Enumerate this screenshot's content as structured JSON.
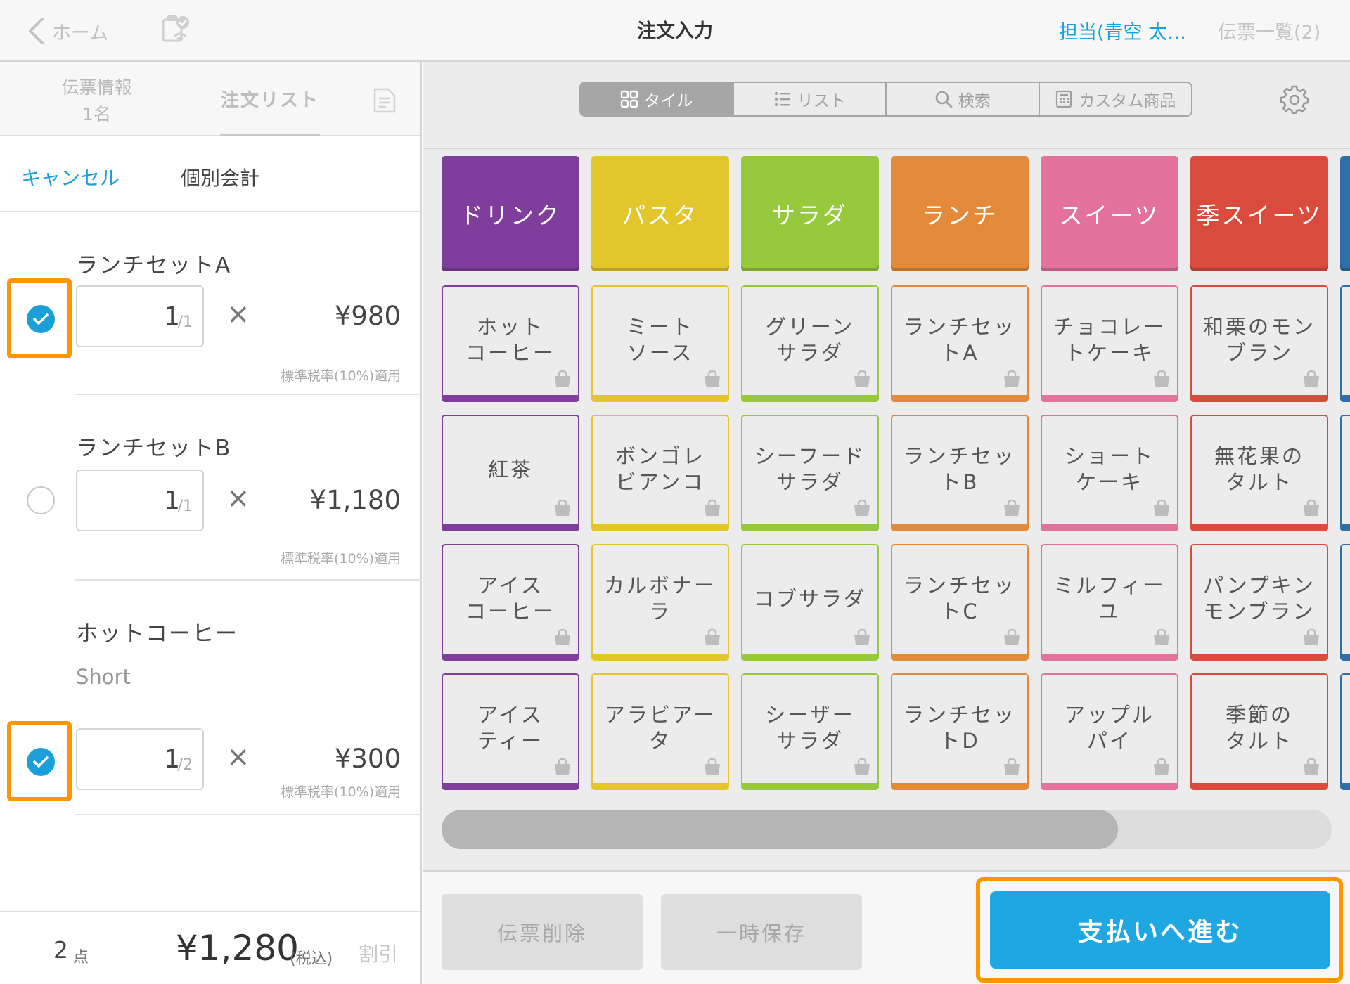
{
  "header": {
    "back_label": "ホーム",
    "title": "注文入力",
    "staff": "担当(青空 太…",
    "slip_list": "伝票一覧(2)"
  },
  "left_tabs": {
    "slip_info_label": "伝票情報",
    "slip_info_count": "1名",
    "order_list_label": "注文リスト"
  },
  "order_actions": {
    "cancel": "キャンセル",
    "split": "個別会計"
  },
  "order_items": [
    {
      "name": "ランチセットA",
      "option": "",
      "qty": "1",
      "qty_total": "/1",
      "times": "×",
      "price": "¥980",
      "tax": "標準税率(10%)適用",
      "checked": true
    },
    {
      "name": "ランチセットB",
      "option": "",
      "qty": "1",
      "qty_total": "/1",
      "times": "×",
      "price": "¥1,180",
      "tax": "標準税率(10%)適用",
      "checked": false
    },
    {
      "name": "ホットコーヒー",
      "option": "Short",
      "qty": "1",
      "qty_total": "/2",
      "times": "×",
      "price": "¥300",
      "tax": "標準税率(10%)適用",
      "checked": true
    }
  ],
  "totals": {
    "count": "2",
    "count_unit": "点",
    "amount": "¥1,280",
    "tax_note": "(税込)",
    "discount": "割引"
  },
  "view_modes": [
    "タイル",
    "リスト",
    "検索",
    "カスタム商品"
  ],
  "view_mode_selected": 0,
  "categories": [
    {
      "label": "ドリンク",
      "color": "#7f3d9c"
    },
    {
      "label": "パスタ",
      "color": "#e3c52c"
    },
    {
      "label": "サラダ",
      "color": "#97c93d"
    },
    {
      "label": "ランチ",
      "color": "#e38b3a"
    },
    {
      "label": "スイーツ",
      "color": "#e3729d"
    },
    {
      "label": "季スイーツ",
      "color": "#d94c3d"
    },
    {
      "label": "",
      "color": "#2d6fa6"
    }
  ],
  "product_rows": [
    [
      "ホット\nコーヒー",
      "ミート\nソース",
      "グリーン\nサラダ",
      "ランチセッ\nトA",
      "チョコレー\nトケーキ",
      "和栗のモン\nブラン",
      ""
    ],
    [
      "紅茶",
      "ボンゴレ\nビアンコ",
      "シーフード\nサラダ",
      "ランチセッ\nトB",
      "ショート\nケーキ",
      "無花果の\nタルト",
      ""
    ],
    [
      "アイス\nコーヒー",
      "カルボナー\nラ",
      "コブサラダ",
      "ランチセッ\nトC",
      "ミルフィー\nユ",
      "パンプキン\nモンブラン",
      ""
    ],
    [
      "アイス\nティー",
      "アラビアー\nタ",
      "シーザー\nサラダ",
      "ランチセッ\nトD",
      "アップル\nパイ",
      "季節の\nタルト",
      ""
    ]
  ],
  "scroll_position": 0.76,
  "bottom_buttons": {
    "delete_slip": "伝票削除",
    "temp_save": "一時保存",
    "proceed_payment": "支払いへ進む"
  },
  "colors": {
    "accent": "#1a9fd8",
    "highlight": "#ff9500"
  }
}
